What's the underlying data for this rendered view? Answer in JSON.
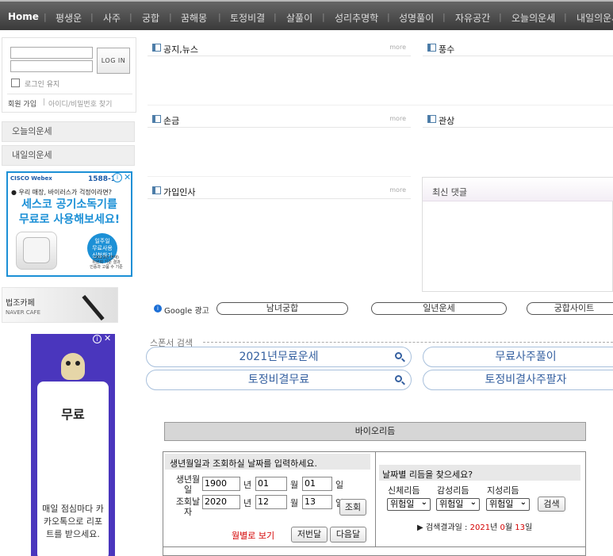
{
  "nav": {
    "items": [
      "Home",
      "평생운",
      "사주",
      "궁합",
      "꿈해몽",
      "토정비결",
      "살풀이",
      "성리추명학",
      "성명풀이",
      "자유공간",
      "오늘의운세",
      "내일의운세"
    ]
  },
  "login": {
    "button": "LOG IN",
    "keep": "로그인 유지",
    "join": "회원 가입",
    "find": "아이디/비밀번호 찾기"
  },
  "side": {
    "today": "오늘의운세",
    "tomorrow": "내일의운세"
  },
  "ad1": {
    "brand": "CISCO Webex",
    "phone": "1588-1",
    "line1": "우리 매장, 바이러스가 걱정이라면?",
    "line2": "세스코 공기소독기를",
    "line3": "무료로 사용해보세요!",
    "badge": "일주일\n무료사용\n신청하기",
    "fine": "(2023년 현재)\n위원회 기준 결과\n인증과 고품 수 기준"
  },
  "cafe": {
    "name": "법조카페",
    "sub": "NAVER CAFE"
  },
  "ad2": {
    "label": "무료",
    "text": "매일 점심마다 카카오톡으로 리포트를 받으세요."
  },
  "boxes": {
    "notice": "공지,뉴스",
    "fengshui": "풍수",
    "palm": "손금",
    "face": "관상",
    "greet": "가입인사",
    "recent": "최신 댓글",
    "more": "more"
  },
  "adbar": {
    "label": "Google 광고",
    "links": [
      "남녀궁합",
      "일년운세",
      "궁합사이트"
    ]
  },
  "sponsor": {
    "label": "스폰서 검색",
    "links": [
      "2021년무료운세",
      "무료사주풀이",
      "토정비결무료",
      "토정비결사주팔자"
    ]
  },
  "bio": {
    "title": "바이오리듬",
    "prompt": "생년월일과 조회하실 날짜를 입력하세요.",
    "birth_label": "생년월\n일",
    "query_label": "조회날\n자",
    "birth": {
      "year": "1900",
      "month": "01",
      "day": "01"
    },
    "query": {
      "year": "2020",
      "month": "12",
      "day": "13"
    },
    "unit_year": "년",
    "unit_month": "월",
    "unit_day": "일",
    "btn_query": "조회",
    "monthly": "월별로 보기",
    "prev": "저번달",
    "next": "다음달",
    "find_title": "날짜별 리듬을 찾으세요?",
    "col1": "신체리듬",
    "col2": "감성리듬",
    "col3": "지성리듬",
    "opt": "위험일",
    "btn_search": "검색",
    "result_prefix": "검색결과일 : ",
    "result_year": "2021",
    "result_year_unit": "년",
    "result_month": "0",
    "result_month_unit": "월",
    "result_day": "13",
    "result_day_unit": "일"
  },
  "colors": {
    "accent": "#3560a0",
    "red": "#d40000",
    "adblue": "#1c90d6",
    "ad2bg": "#4a36bd"
  }
}
